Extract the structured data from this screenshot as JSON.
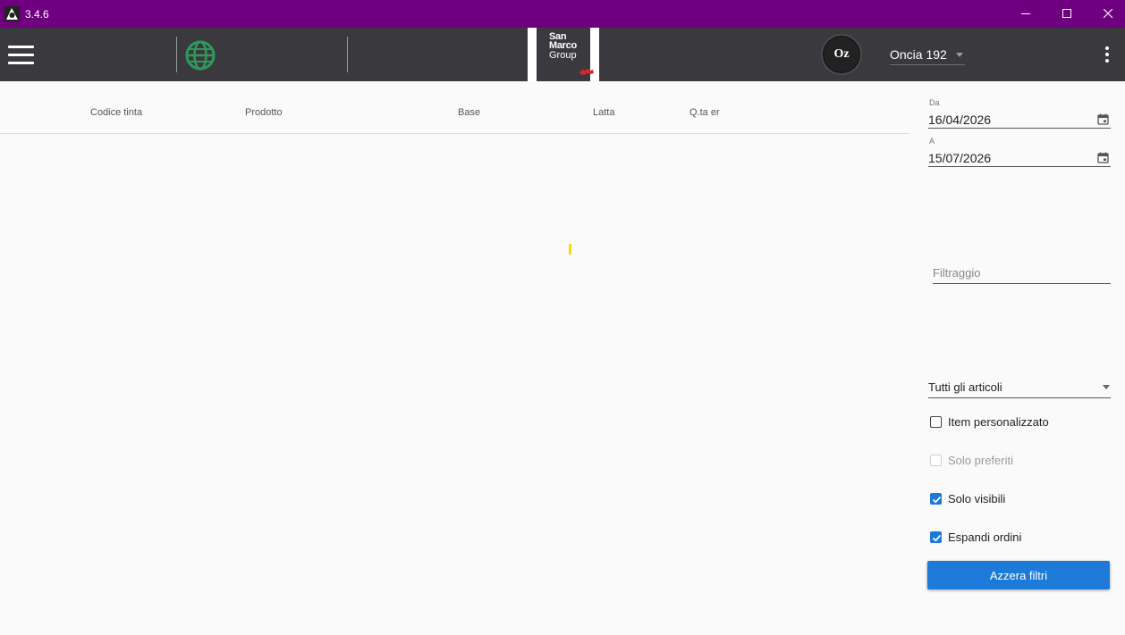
{
  "window": {
    "title": "3.4.6",
    "icon": "app-icon"
  },
  "appbar": {
    "menu_icon": "hamburger-menu-icon",
    "globe_icon": "globe-icon",
    "logo": {
      "line1": "San",
      "line2": "Marco",
      "line3": "Group"
    },
    "oz_badge": "Oz",
    "unit_select": "Oncia 192",
    "more_icon": "kebab-menu-icon"
  },
  "table": {
    "columns": [
      "Codice tinta",
      "Prodotto",
      "Base",
      "Latta",
      "Q.ta er"
    ]
  },
  "filters": {
    "date_from": {
      "label": "Da",
      "value": "16/04/2026"
    },
    "date_to": {
      "label": "A",
      "value": "15/07/2026"
    },
    "filter_placeholder": "Filtraggio",
    "articles_select": "Tutti gli articoli",
    "checkboxes": [
      {
        "label": "Item personalizzato",
        "checked": false,
        "disabled": false
      },
      {
        "label": "Solo preferiti",
        "checked": false,
        "disabled": true
      },
      {
        "label": "Solo visibili",
        "checked": true,
        "disabled": false
      },
      {
        "label": "Espandi ordini",
        "checked": true,
        "disabled": false
      }
    ],
    "reset_button": "Azzera filtri"
  },
  "colors": {
    "titlebar": "#6e0080",
    "appbar": "#3a393e",
    "accent": "#1e7ad8",
    "globe": "#2e9a5a",
    "loader": "#f2e100"
  }
}
